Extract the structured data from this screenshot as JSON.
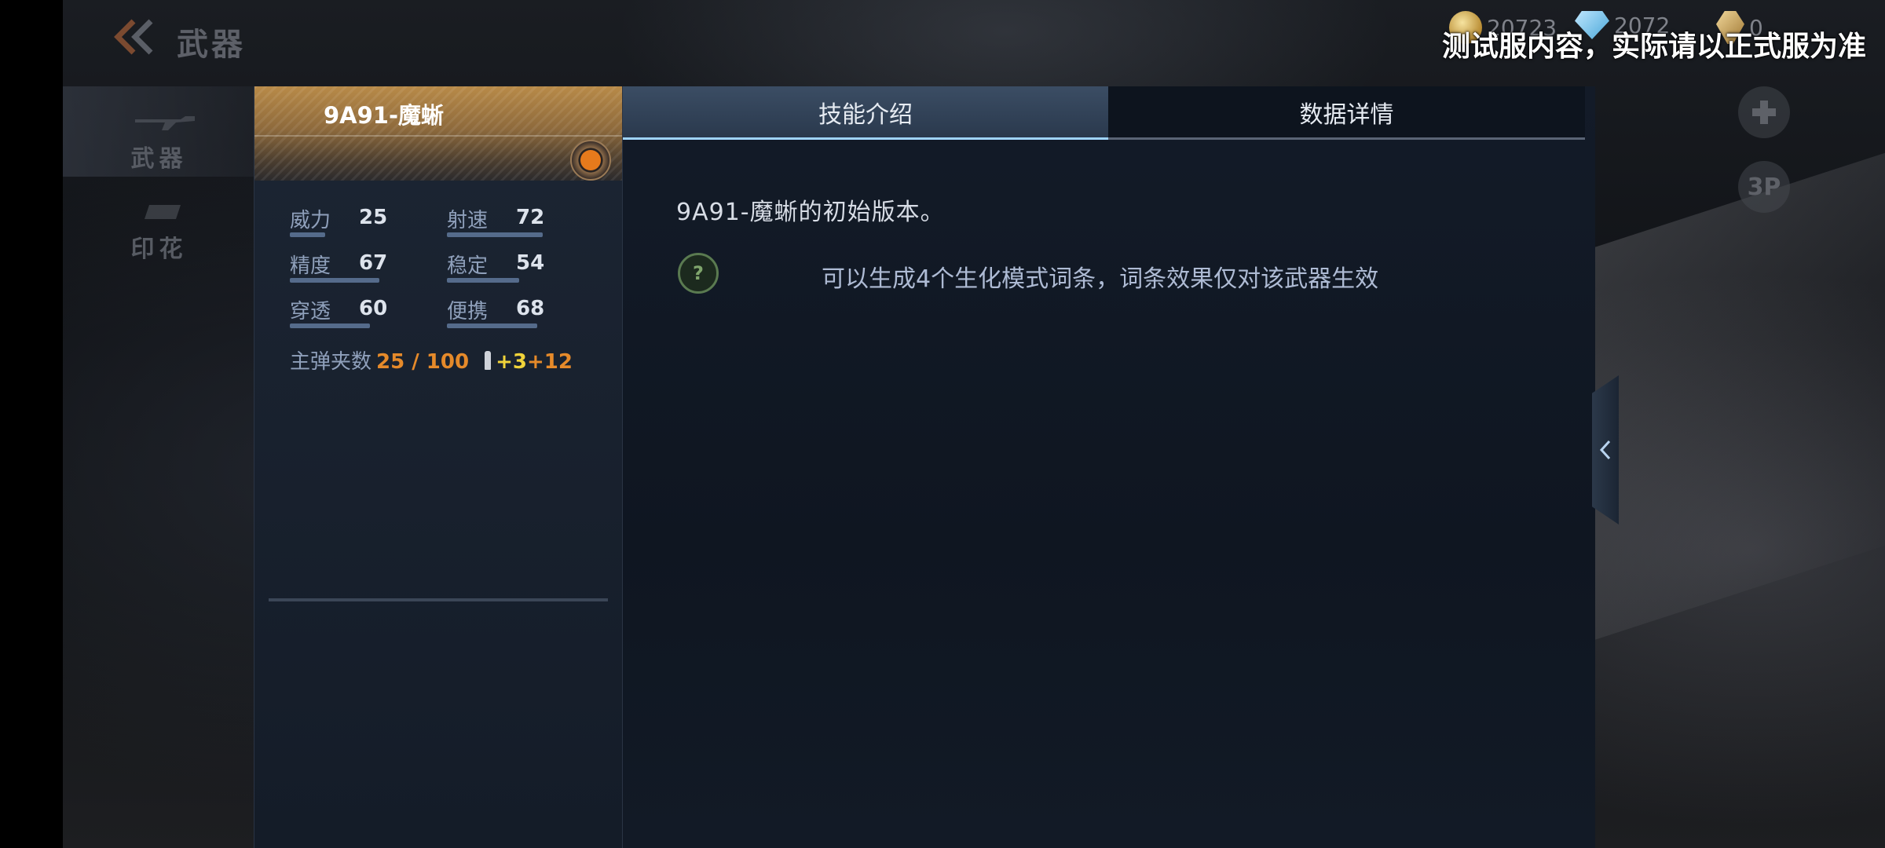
{
  "header": {
    "title": "武器"
  },
  "side_nav": {
    "items": [
      {
        "label": "武器",
        "active": true
      },
      {
        "label": "印花",
        "active": false
      }
    ]
  },
  "currency": {
    "gold": "20723",
    "diamond": "2072",
    "ticket": "0"
  },
  "watermark": "测试服内容，实际请以正式服为准",
  "round_buttons": {
    "view_mode": "3P"
  },
  "weapon": {
    "name": "9A91-魔蜥",
    "stats": [
      {
        "label": "威力",
        "value": "25"
      },
      {
        "label": "射速",
        "value": "72"
      },
      {
        "label": "精度",
        "value": "67"
      },
      {
        "label": "稳定",
        "value": "54"
      },
      {
        "label": "穿透",
        "value": "60"
      },
      {
        "label": "便携",
        "value": "68"
      }
    ],
    "magazine": {
      "label": "主弹夹数",
      "value": "25 / 100",
      "bonus_yellow": "+3",
      "bonus_orange": "+12"
    }
  },
  "tabs": [
    {
      "label": "技能介绍",
      "active": true
    },
    {
      "label": "数据详情",
      "active": false
    }
  ],
  "skill": {
    "description": "9A91-魔蜥的初始版本。",
    "effect_text": "可以生成4个生化模式词条，词条效果仅对该武器生效",
    "effect_icon_glyph": "?"
  },
  "colors": {
    "gold_header": "#b88a48",
    "accent_tab": "#9fd4ff",
    "stat_bar": "#556b8b",
    "magazine_orange": "#e58a2a",
    "magazine_yellow": "#f0d33a"
  }
}
